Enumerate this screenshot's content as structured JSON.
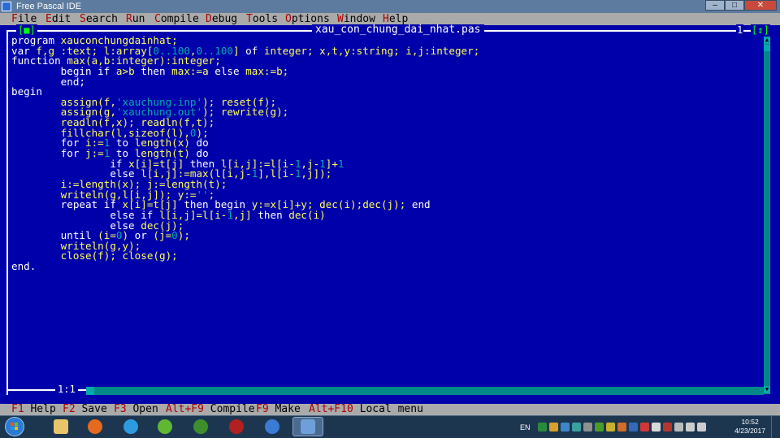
{
  "window": {
    "title": "Free Pascal IDE",
    "minimize": "–",
    "maximize": "□",
    "close": "✕"
  },
  "menu": [
    {
      "hot": "F",
      "rest": "ile"
    },
    {
      "hot": "E",
      "rest": "dit"
    },
    {
      "hot": "S",
      "rest": "earch"
    },
    {
      "hot": "R",
      "rest": "un"
    },
    {
      "hot": "C",
      "rest": "ompile"
    },
    {
      "hot": "D",
      "rest": "ebug"
    },
    {
      "hot": "T",
      "rest": "ools"
    },
    {
      "hot": "O",
      "rest": "ptions"
    },
    {
      "hot": "W",
      "rest": "indow"
    },
    {
      "hot": "H",
      "rest": "elp"
    }
  ],
  "editor": {
    "filename": "xau_con_chung_dai_nhat.pas",
    "window_number": "1",
    "close_glyph": "[■]",
    "zoom_glyph": "[↕]",
    "cursor_position": "1:1",
    "code": [
      [
        [
          "kw",
          "program "
        ],
        [
          "id",
          "xauconchungdainhat;"
        ]
      ],
      [
        [
          "kw",
          "var "
        ],
        [
          "id",
          "f,g :text; l:array["
        ],
        [
          "num",
          "0..100"
        ],
        [
          "id",
          ","
        ],
        [
          "num",
          "0..100"
        ],
        [
          "id",
          "] "
        ],
        [
          "kw",
          "of "
        ],
        [
          "id",
          "integer; x,t,y:string; i,j:integer;"
        ]
      ],
      [
        [
          "kw",
          "function "
        ],
        [
          "id",
          "max(a,b:integer):integer;"
        ]
      ],
      [
        [
          "kw",
          "        begin if "
        ],
        [
          "id",
          "a>b "
        ],
        [
          "kw",
          "then "
        ],
        [
          "id",
          "max:=a "
        ],
        [
          "kw",
          "else "
        ],
        [
          "id",
          "max:=b;"
        ]
      ],
      [
        [
          "kw",
          "        end;"
        ]
      ],
      [
        [
          "kw",
          "begin"
        ]
      ],
      [
        [
          "kw",
          "        "
        ],
        [
          "id",
          "assign(f,"
        ],
        [
          "str",
          "'xauchung.inp'"
        ],
        [
          "id",
          "); reset(f);"
        ]
      ],
      [
        [
          "kw",
          "        "
        ],
        [
          "id",
          "assign(g,"
        ],
        [
          "str",
          "'xauchung.out'"
        ],
        [
          "id",
          "); rewrite(g);"
        ]
      ],
      [
        [
          "kw",
          "        "
        ],
        [
          "id",
          "readln(f,x); readln(f,t);"
        ]
      ],
      [
        [
          "kw",
          "        "
        ],
        [
          "id",
          "fillchar(l,sizeof(l),"
        ],
        [
          "num",
          "0"
        ],
        [
          "id",
          ");"
        ]
      ],
      [
        [
          "kw",
          "        for "
        ],
        [
          "id",
          "i:="
        ],
        [
          "num",
          "1"
        ],
        [
          "kw",
          " to "
        ],
        [
          "id",
          "length(x) "
        ],
        [
          "kw",
          "do"
        ]
      ],
      [
        [
          "kw",
          "        for "
        ],
        [
          "id",
          "j:="
        ],
        [
          "num",
          "1"
        ],
        [
          "kw",
          " to "
        ],
        [
          "id",
          "length(t) "
        ],
        [
          "kw",
          "do"
        ]
      ],
      [
        [
          "kw",
          "                if "
        ],
        [
          "id",
          "x[i]=t[j] "
        ],
        [
          "kw",
          "then "
        ],
        [
          "id",
          "l[i,j]:=l[i-"
        ],
        [
          "num",
          "1"
        ],
        [
          "id",
          ",j-"
        ],
        [
          "num",
          "1"
        ],
        [
          "id",
          "]+"
        ],
        [
          "num",
          "1"
        ]
      ],
      [
        [
          "kw",
          "                else "
        ],
        [
          "id",
          "l[i,j]:=max(l[i,j-"
        ],
        [
          "num",
          "1"
        ],
        [
          "id",
          "],l[i-"
        ],
        [
          "num",
          "1"
        ],
        [
          "id",
          ",j]);"
        ]
      ],
      [
        [
          "kw",
          "        "
        ],
        [
          "id",
          "i:=length(x); j:=length(t);"
        ]
      ],
      [
        [
          "kw",
          "        "
        ],
        [
          "id",
          "writeln(g,l[i,j]); y:="
        ],
        [
          "str",
          "''"
        ],
        [
          "id",
          ";"
        ]
      ],
      [
        [
          "kw",
          "        repeat if "
        ],
        [
          "id",
          "x[i]=t[j] "
        ],
        [
          "kw",
          "then begin "
        ],
        [
          "id",
          "y:=x[i]+y; dec(i);dec(j); "
        ],
        [
          "kw",
          "end"
        ]
      ],
      [
        [
          "kw",
          "                else if "
        ],
        [
          "id",
          "l[i,j]=l[i-"
        ],
        [
          "num",
          "1"
        ],
        [
          "id",
          ",j] "
        ],
        [
          "kw",
          "then "
        ],
        [
          "id",
          "dec(i)"
        ]
      ],
      [
        [
          "kw",
          "                else "
        ],
        [
          "id",
          "dec(j);"
        ]
      ],
      [
        [
          "kw",
          "        until "
        ],
        [
          "id",
          "(i="
        ],
        [
          "num",
          "0"
        ],
        [
          "id",
          ") "
        ],
        [
          "kw",
          "or "
        ],
        [
          "id",
          "(j="
        ],
        [
          "num",
          "0"
        ],
        [
          "id",
          ");"
        ]
      ],
      [
        [
          "kw",
          "        "
        ],
        [
          "id",
          "writeln(g,y);"
        ]
      ],
      [
        [
          "kw",
          "        "
        ],
        [
          "id",
          "close(f); close(g);"
        ]
      ],
      [
        [
          "kw",
          "end."
        ]
      ]
    ]
  },
  "status_hints": [
    {
      "key": "F1",
      "label": " Help"
    },
    {
      "key": "F2",
      "label": " Save"
    },
    {
      "key": "F3",
      "label": " Open"
    },
    {
      "key": "Alt+F9",
      "label": " Compile"
    },
    {
      "key": "F9",
      "label": " Make"
    },
    {
      "key": "Alt+F10",
      "label": " Local menu"
    }
  ],
  "taskbar": {
    "language": "EN",
    "time": "10:52",
    "date": "4/23/2017",
    "apps": [
      "windows-explorer-icon",
      "media-player-icon",
      "internet-explorer-icon",
      "coccoc-browser-icon",
      "green-app-icon",
      "red-app-icon",
      "chrome-icon",
      "free-pascal-icon"
    ]
  },
  "colors": {
    "editor_bg": "#0000aa",
    "keyword": "#ffffff",
    "identifier": "#ffff55",
    "number": "#00aaaa",
    "menu_bg": "#aaaaaa",
    "hotkey": "#aa0000"
  }
}
